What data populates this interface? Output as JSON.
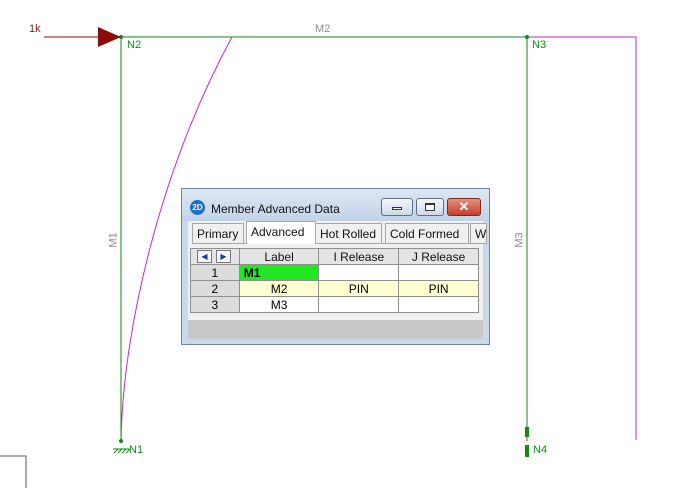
{
  "load": {
    "label": "1k"
  },
  "nodes": [
    {
      "id": "n1",
      "label": "N1"
    },
    {
      "id": "n2",
      "label": "N2"
    },
    {
      "id": "n3",
      "label": "N3"
    },
    {
      "id": "n4",
      "label": "N4"
    }
  ],
  "members": [
    {
      "id": "m1",
      "label": "M1"
    },
    {
      "id": "m2",
      "label": "M2"
    },
    {
      "id": "m3",
      "label": "M3"
    }
  ],
  "dialog": {
    "app_icon": "2D",
    "title": "Member Advanced Data",
    "close_glyph": "✕",
    "tabs": [
      "Primary",
      "Advanced",
      "Hot Rolled",
      "Cold Formed",
      "W"
    ],
    "active_tab": "Advanced",
    "nav_prev": "◀",
    "nav_next": "▶",
    "columns": [
      "Label",
      "I Release",
      "J Release"
    ],
    "rows": [
      {
        "num": "1",
        "label": "M1",
        "i_release": "",
        "j_release": ""
      },
      {
        "num": "2",
        "label": "M2",
        "i_release": "PIN",
        "j_release": "PIN"
      },
      {
        "num": "3",
        "label": "M3",
        "i_release": "",
        "j_release": ""
      }
    ]
  },
  "colors": {
    "frame": "#128a12",
    "deflection": "#cc22cc",
    "load": "#8b0a0a",
    "selected_cell": "#22e822",
    "pinned_row": "#ffffd2"
  }
}
